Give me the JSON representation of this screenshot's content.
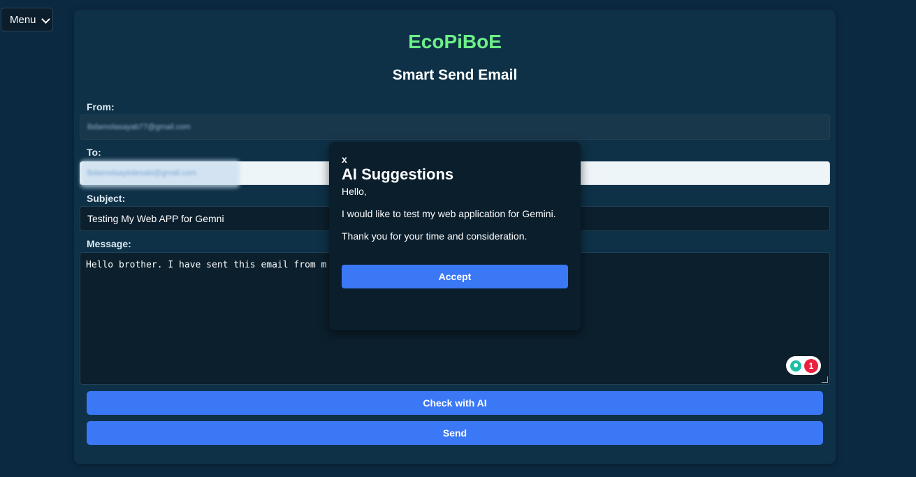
{
  "menu": {
    "selected": "Menu"
  },
  "app": {
    "title": "EcoPiBoE",
    "form_title": "Smart Send Email"
  },
  "form": {
    "from_label": "From:",
    "from_value": "lbdamolasayab77@gmail.com",
    "to_label": "To:",
    "to_value": "lbdamolaaybdesabi@gmail.com",
    "subject_label": "Subject:",
    "subject_value": "Testing My Web APP for Gemni",
    "message_label": "Message:",
    "message_value": "Hello brother. I have sent this email from m",
    "check_button": "Check with AI",
    "send_button": "Send"
  },
  "extension": {
    "count": "1"
  },
  "modal": {
    "close_label": "x",
    "title": "AI Suggestions",
    "lines": [
      "Hello,",
      "I would like to test my web application for Gemini.",
      "Thank you for your time and consideration."
    ],
    "accept_button": "Accept"
  },
  "colors": {
    "background": "#0b2a42",
    "card": "#0e3147",
    "title_green": "#6cf088",
    "button_blue": "#3b78f5",
    "badge_red": "#e8223f"
  }
}
